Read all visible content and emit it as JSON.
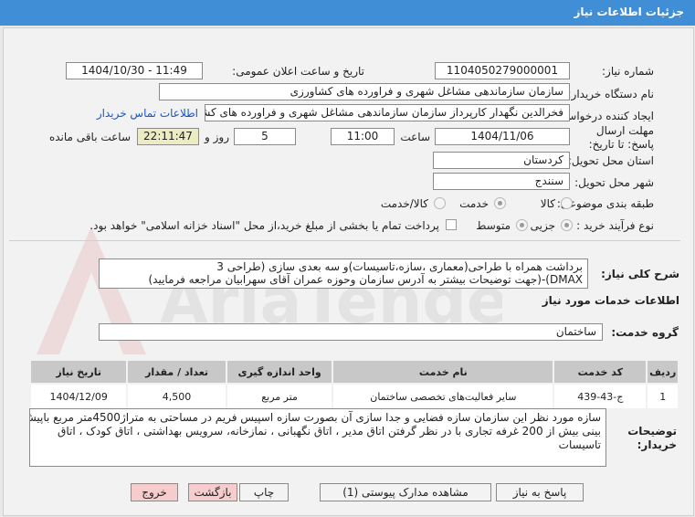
{
  "window": {
    "title": "جزئیات اطلاعات نیاز"
  },
  "fields": {
    "need_number_label": "شماره نیاز:",
    "need_number": "1104050279000001",
    "announce_label": "تاریخ و ساعت اعلان عمومی:",
    "announce_value": "1404/10/30 - 11:49",
    "buyer_org_label": "نام دستگاه خریدار:",
    "buyer_org": "سازمان سازماندهی مشاغل شهری و فراورده های کشاورزی",
    "creator_label": "ایجاد کننده درخواست:",
    "creator": "فخرالدین نگهدار کارپرداز سازمان سازماندهی مشاغل شهری و فراورده های کشاورزی",
    "contact_link": "اطلاعات تماس خریدار",
    "deadline_label": "مهلت ارسال پاسخ: تا تاریخ:",
    "deadline_date": "1404/11/06",
    "time_label": "ساعت",
    "deadline_time": "11:00",
    "days_value": "5",
    "days_label": "روز و",
    "remaining_time": "22:11:47",
    "remaining_label": "ساعت باقی مانده",
    "province_label": "استان محل تحویل:",
    "province": "کردستان",
    "city_label": "شهر محل تحویل:",
    "city": "سنندج",
    "category_label": "طبقه بندی موضوعی:",
    "category_options": [
      "کالا",
      "خدمت",
      "کالا/خدمت"
    ],
    "category_selected": "خدمت",
    "process_label": "نوع فرآیند خرید :",
    "process_options": [
      "جزیی",
      "متوسط"
    ],
    "process_selected": "جزیی",
    "payment_note": "پرداخت تمام یا بخشی از مبلغ خرید،از محل \"اسناد خزانه اسلامی\" خواهد بود."
  },
  "description": {
    "label": "شرح کلی نیاز:",
    "line1": "برداشت همراه با طراحی(معماری ،سازه،تاسیسات)و سه بعدی سازی (طراحی 3",
    "line2": "DMAX)-(جهت توضیحات بیشتر به آدرس سازمان وحوزه عمران آقای سهرابیان مراجعه فرمایید)"
  },
  "services": {
    "section_title": "اطلاعات خدمات مورد نیاز",
    "group_label": "گروه خدمت:",
    "group_value": "ساختمان",
    "columns": [
      "ردیف",
      "کد خدمت",
      "نام خدمت",
      "واحد اندازه گیری",
      "تعداد / مقدار",
      "تاریخ نیاز"
    ],
    "rows": [
      {
        "row": "1",
        "code": "ج-43-439",
        "name": "سایر فعالیت‌های تخصصی ساختمان",
        "unit": "متر مربع",
        "qty": "4,500",
        "date": "1404/12/09"
      }
    ]
  },
  "buyer_notes": {
    "label": "توضیحات خریدار:",
    "line1": "سازه مورد نظر این سازمان سازه فضایی و جدا سازی آن بصورت سازه اسپیس فریم در مساحتی به متراژ4500متر مربع باپیش",
    "line2": "بینی بیش از 200 غرفه تجاری با در نظر گرفتن اتاق مدیر ، اتاق نگهبانی ، نمازخانه، سرویس بهداشتی ، اتاق کودک ، اتاق",
    "line3": "تاسیسات"
  },
  "buttons": {
    "reply": "پاسخ به نیاز",
    "attachments": "مشاهده مدارک پیوستی (1)",
    "print": "چاپ",
    "back": "بازگشت",
    "exit": "خروج"
  },
  "watermark": {
    "text": "AriaTender.net"
  },
  "colors": {
    "titlebar": "#3f8ed6",
    "link": "#1a55c7",
    "danger_button": "#f6cccc"
  }
}
